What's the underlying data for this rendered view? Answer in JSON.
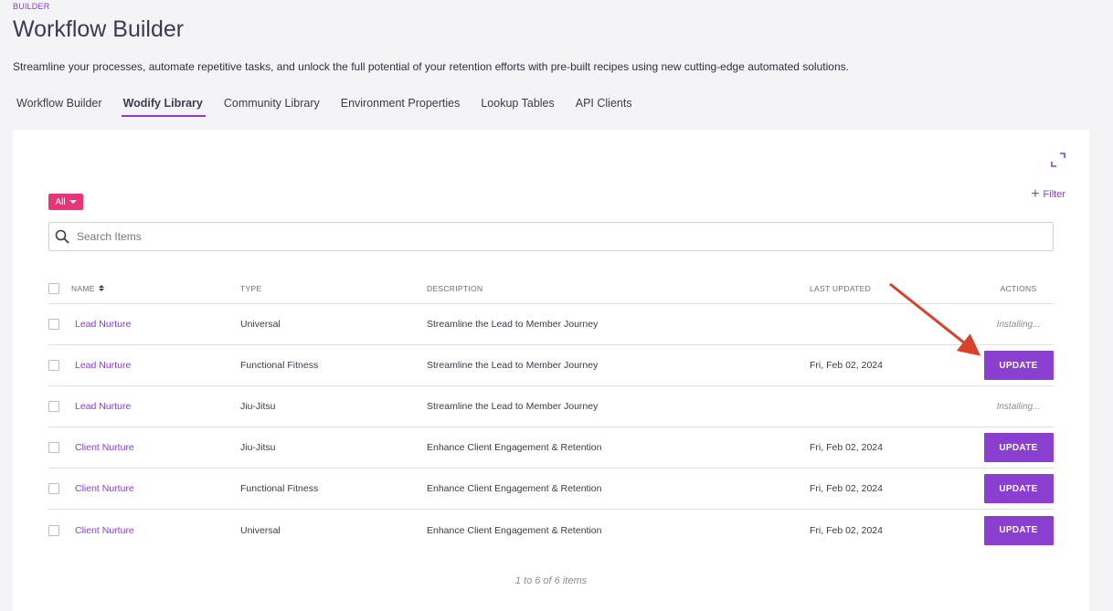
{
  "header": {
    "breadcrumb": "BUILDER",
    "title": "Workflow Builder",
    "description": "Streamline your processes, automate repetitive tasks, and unlock the full potential of your retention efforts with pre-built recipes using new cutting-edge automated solutions."
  },
  "tabs": [
    {
      "label": "Workflow Builder",
      "active": false
    },
    {
      "label": "Wodify Library",
      "active": true
    },
    {
      "label": "Community Library",
      "active": false
    },
    {
      "label": "Environment Properties",
      "active": false
    },
    {
      "label": "Lookup Tables",
      "active": false
    },
    {
      "label": "API Clients",
      "active": false
    }
  ],
  "toolbar": {
    "all_label": "All",
    "filter_label": "Filter",
    "search_placeholder": "Search Items"
  },
  "table": {
    "columns": {
      "name": "NAME",
      "type": "TYPE",
      "description": "DESCRIPTION",
      "last_updated": "LAST UPDATED",
      "actions": "ACTIONS"
    },
    "rows": [
      {
        "name": "Lead Nurture",
        "type": "Universal",
        "description": "Streamline the Lead to Member Journey",
        "last_updated": "",
        "action": "Installing..."
      },
      {
        "name": "Lead Nurture",
        "type": "Functional Fitness",
        "description": "Streamline the Lead to Member Journey",
        "last_updated": "Fri, Feb 02, 2024",
        "action": "UPDATE"
      },
      {
        "name": "Lead Nurture",
        "type": "Jiu-Jitsu",
        "description": "Streamline the Lead to Member Journey",
        "last_updated": "",
        "action": "Installing..."
      },
      {
        "name": "Client Nurture",
        "type": "Jiu-Jitsu",
        "description": "Enhance Client Engagement & Retention",
        "last_updated": "Fri, Feb 02, 2024",
        "action": "UPDATE"
      },
      {
        "name": "Client Nurture",
        "type": "Functional Fitness",
        "description": "Enhance Client Engagement & Retention",
        "last_updated": "Fri, Feb 02, 2024",
        "action": "UPDATE"
      },
      {
        "name": "Client Nurture",
        "type": "Universal",
        "description": "Enhance Client Engagement & Retention",
        "last_updated": "Fri, Feb 02, 2024",
        "action": "UPDATE"
      }
    ]
  },
  "pagination": "1 to 6 of 6 items",
  "colors": {
    "accent": "#8a3fd1",
    "badge": "#e8357a",
    "annotation_arrow": "#d9412b"
  },
  "icons": [
    "expand-icon",
    "plus-icon",
    "search-icon",
    "sort-icon",
    "caret-down-icon",
    "arrow-annotation"
  ]
}
